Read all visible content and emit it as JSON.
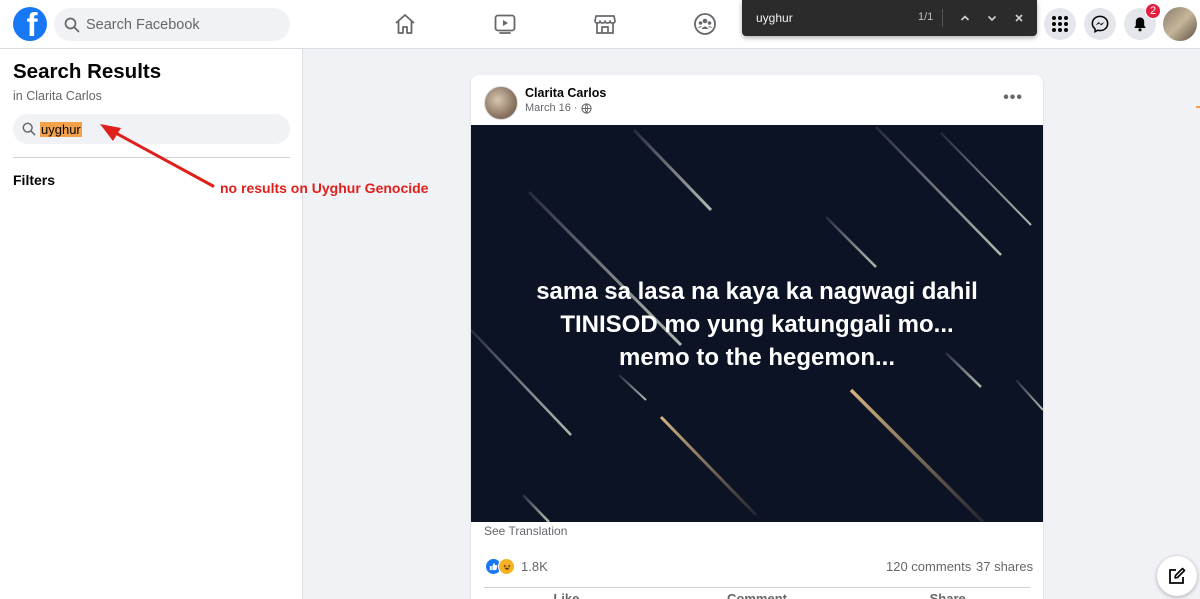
{
  "header": {
    "logo_letter": "f",
    "search_placeholder": "Search Facebook",
    "nav": [
      "home-icon",
      "watch-icon",
      "marketplace-icon",
      "groups-icon"
    ],
    "notification_count": "2"
  },
  "find_bar": {
    "query": "uyghur",
    "count": "1/1"
  },
  "left_panel": {
    "title": "Search Results",
    "subtitle": "in Clarita Carlos",
    "search_value": "uyghur",
    "filters_label": "Filters"
  },
  "annotation": {
    "text": "no results on Uyghur Genocide",
    "color": "#e0201c"
  },
  "post": {
    "author": "Clarita Carlos",
    "date": "March 16",
    "date_separator": "·",
    "more": "•••",
    "image_text_lines": [
      "sama sa lasa na kaya ka nagwagi dahil",
      "TINISOD mo yung katunggali mo...",
      "memo to the hegemon..."
    ],
    "see_translation": "See Translation",
    "reaction_count": "1.8K",
    "comments": "120 comments",
    "shares": "37 shares",
    "actions": [
      "Like",
      "Comment",
      "Share"
    ]
  },
  "colors": {
    "brand": "#1877f2",
    "highlight": "#f4a14a",
    "badge": "#e41e3f"
  }
}
